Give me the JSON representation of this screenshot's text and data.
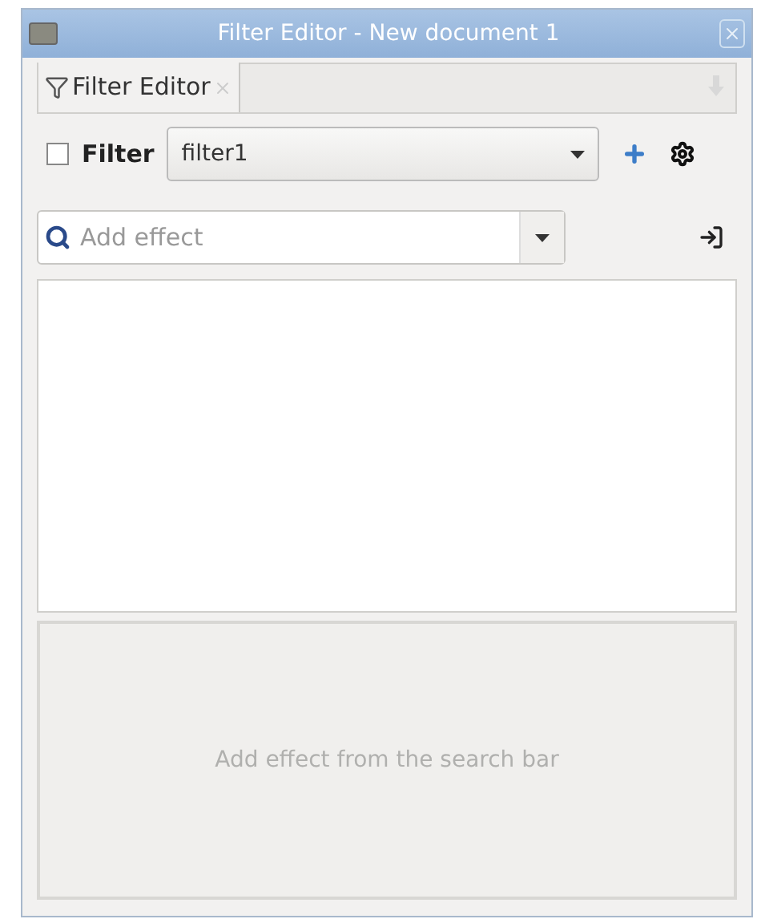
{
  "window": {
    "title": "Filter Editor - New document 1"
  },
  "tabs": [
    {
      "label": "Filter Editor",
      "selected": true
    }
  ],
  "filter": {
    "checked": false,
    "label": "Filter",
    "value": "filter1"
  },
  "search": {
    "placeholder": "Add effect"
  },
  "effects_panel": {
    "empty_message": "Add effect from the search bar"
  }
}
